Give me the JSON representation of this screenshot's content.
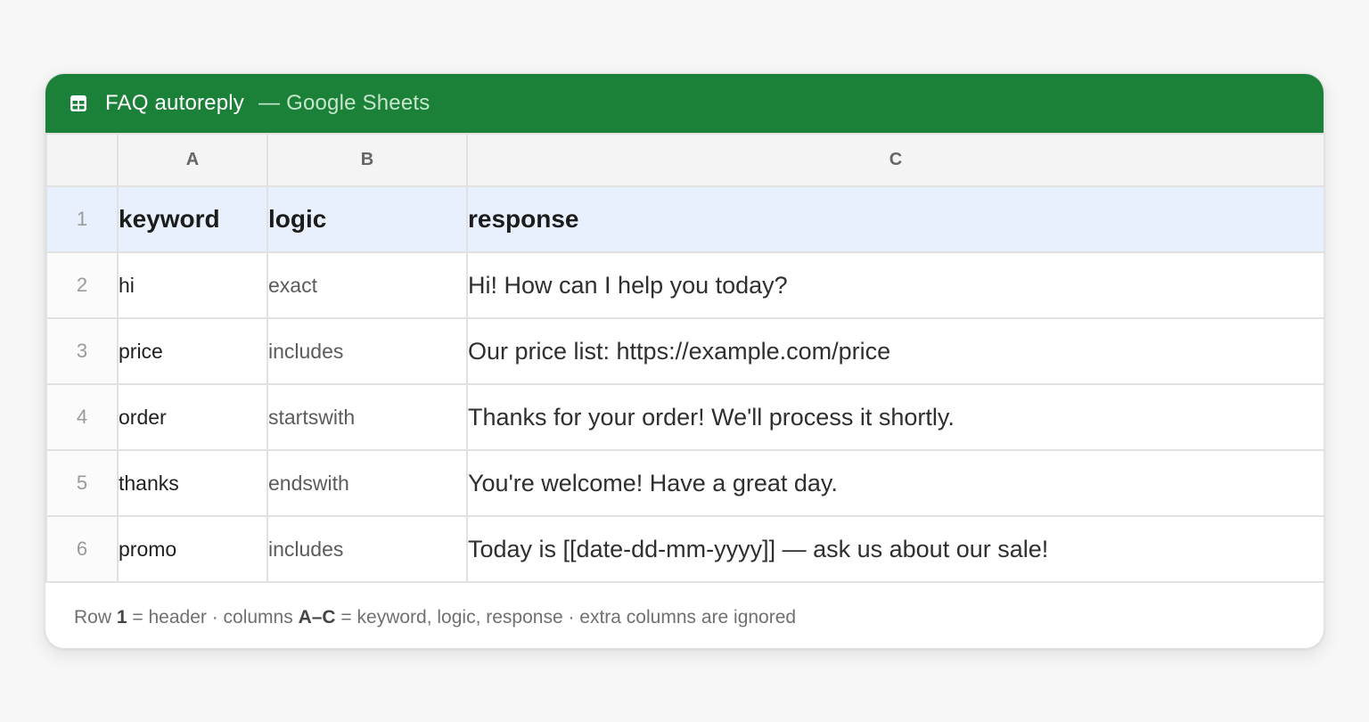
{
  "window": {
    "title": "FAQ autoreply",
    "subtitle": "— Google Sheets",
    "icon": "sheets-grid-icon",
    "accent": "#1b8139"
  },
  "grid": {
    "columns": [
      "A",
      "B",
      "C"
    ],
    "rows": [
      {
        "num": "1",
        "keyword": "keyword",
        "logic": "logic",
        "response": "response"
      },
      {
        "num": "2",
        "keyword": "hi",
        "logic": "exact",
        "response": "Hi! How can I help you today?"
      },
      {
        "num": "3",
        "keyword": "price",
        "logic": "includes",
        "response": "Our price list: https://example.com/price"
      },
      {
        "num": "4",
        "keyword": "order",
        "logic": "startswith",
        "response": "Thanks for your order! We'll process it shortly."
      },
      {
        "num": "5",
        "keyword": "thanks",
        "logic": "endswith",
        "response": "You're welcome! Have a great day."
      },
      {
        "num": "6",
        "keyword": "promo",
        "logic": "includes",
        "response": "Today is [[date-dd-mm-yyyy]] — ask us about our sale!"
      }
    ]
  },
  "footer": {
    "p1": "Row ",
    "b1": "1",
    "p2": " = header · columns ",
    "b2": "A–C",
    "p3": " = keyword, logic, response · extra columns are ignored"
  }
}
